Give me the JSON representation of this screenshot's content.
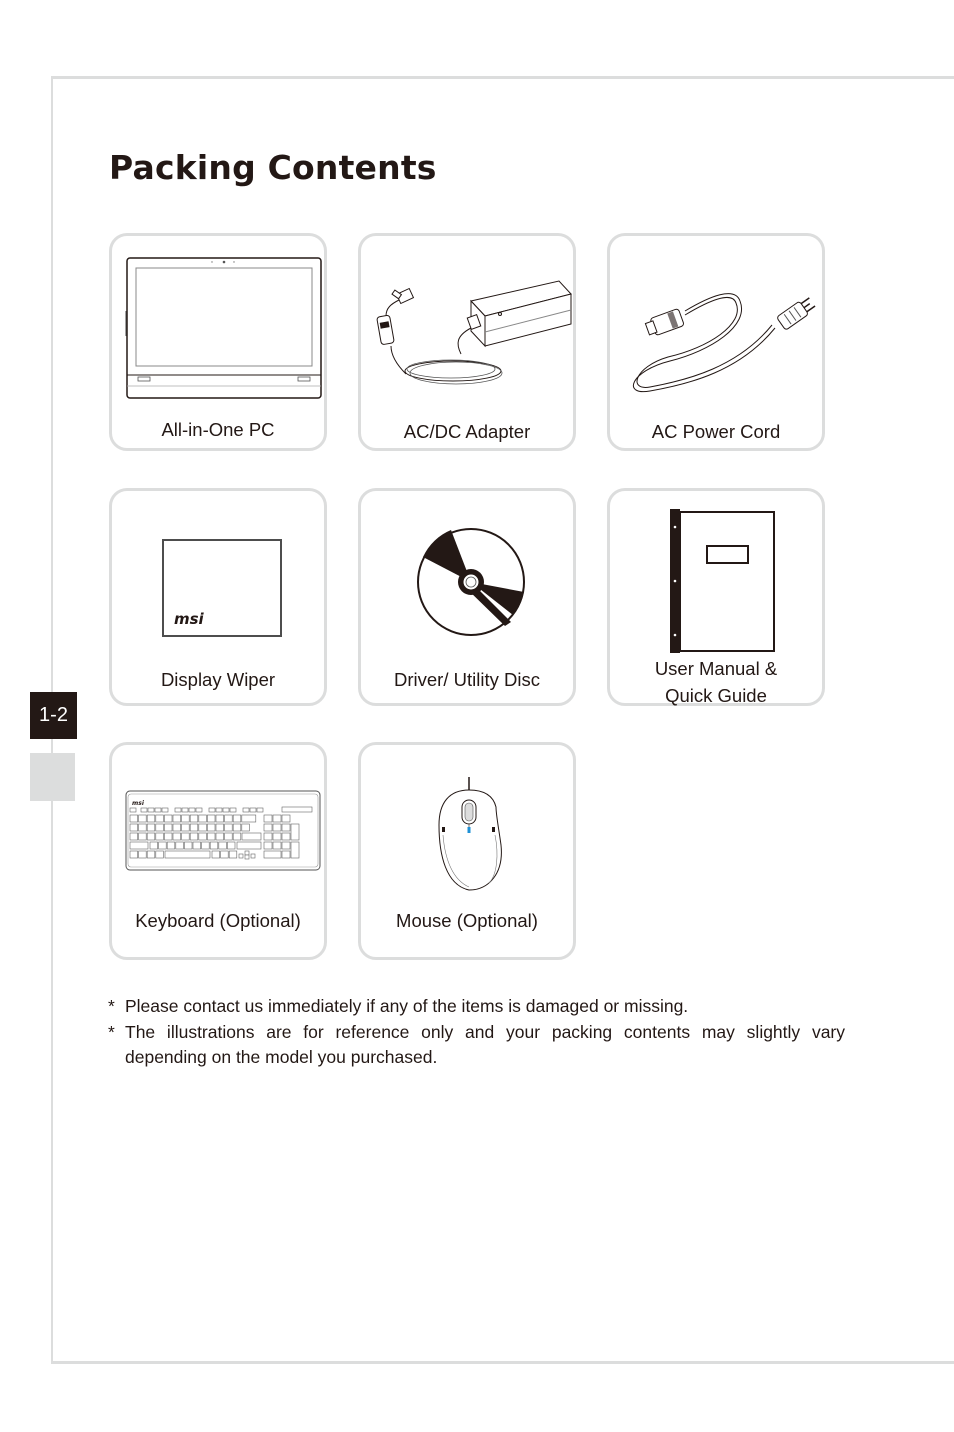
{
  "page": {
    "title": "Packing Contents",
    "page_tab": "1-2"
  },
  "items": [
    {
      "label": "All-in-One PC",
      "icon": "all-in-one-pc-icon"
    },
    {
      "label": "AC/DC Adapter",
      "icon": "ac-dc-adapter-icon"
    },
    {
      "label": "AC Power Cord",
      "icon": "power-cord-icon"
    },
    {
      "label": "Display Wiper",
      "icon": "display-wiper-icon",
      "brand": "msi"
    },
    {
      "label": "Driver/ Utility Disc",
      "icon": "disc-icon"
    },
    {
      "label_line1": "User Manual &",
      "label_line2": "Quick Guide",
      "icon": "manual-icon"
    },
    {
      "label": "Keyboard (Optional)",
      "icon": "keyboard-icon",
      "brand": "msi"
    },
    {
      "label": "Mouse (Optional)",
      "icon": "mouse-icon"
    }
  ],
  "notes": [
    {
      "marker": "*",
      "text": "Please contact us immediately if any of the items is damaged or missing."
    },
    {
      "marker": "*",
      "text": "The illustrations are for reference only and your packing contents may slightly vary depending on the model you purchased."
    }
  ],
  "colors": {
    "text": "#231815",
    "frame": "#dcdddd",
    "mouse_accent": "#1e90d6"
  }
}
